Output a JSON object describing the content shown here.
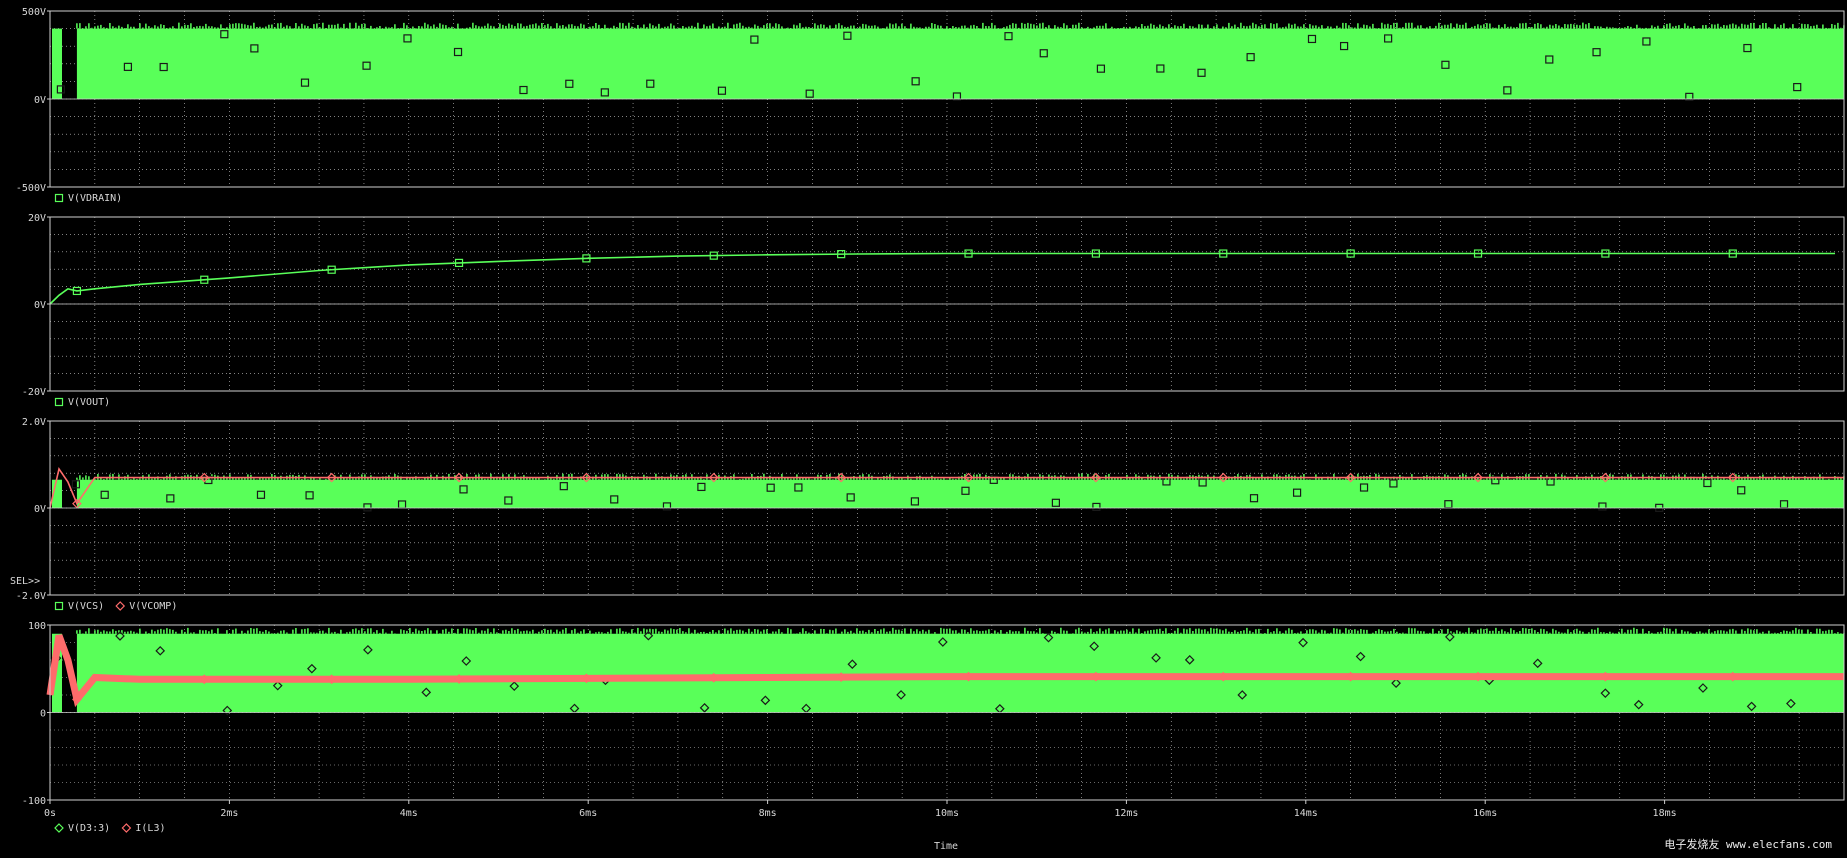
{
  "colors": {
    "background": "#000000",
    "frame": "#cfcfcf",
    "grid": "#cfcfcf",
    "text": "#d8d8d8",
    "trace_green": "#59ff59",
    "trace_red": "#ff6b6b"
  },
  "x_axis": {
    "label": "Time",
    "tick_labels": [
      "0s",
      "2ms",
      "4ms",
      "6ms",
      "8ms",
      "10ms",
      "12ms",
      "14ms",
      "16ms",
      "18ms"
    ],
    "range_ms": [
      0,
      20
    ]
  },
  "sel_marker": "SEL>>",
  "watermark_text": "电子发烧友 www.elecfans.com",
  "chart_data": [
    {
      "type": "line",
      "ylim": [
        -500,
        500
      ],
      "y_tick_labels": [
        "500V",
        "0V",
        "-500V"
      ],
      "y_tick_values": [
        500,
        0,
        -500
      ],
      "series": [
        {
          "name": "V(VDRAIN)",
          "marker": "square",
          "color": "#59ff59",
          "style": "band",
          "band": [
            0,
            400
          ],
          "start_ms": 0.3
        }
      ]
    },
    {
      "type": "line",
      "ylim": [
        -20,
        20
      ],
      "y_tick_labels": [
        "20V",
        "0V",
        "-20V"
      ],
      "y_tick_values": [
        20,
        0,
        -20
      ],
      "series": [
        {
          "name": "V(VOUT)",
          "marker": "square",
          "color": "#59ff59",
          "style": "line",
          "x": [
            0,
            0.1,
            0.2,
            0.3,
            0.5,
            1.0,
            2.0,
            3.0,
            4.0,
            5.0,
            6.0,
            7.0,
            8.0,
            9.0,
            10.0,
            11.0,
            12.0,
            14.0,
            16.0,
            18.0,
            19.9
          ],
          "y": [
            0,
            2.0,
            3.5,
            3.0,
            3.5,
            4.5,
            6.0,
            7.7,
            9.0,
            9.8,
            10.5,
            11.0,
            11.3,
            11.5,
            11.6,
            11.6,
            11.6,
            11.6,
            11.6,
            11.6,
            11.6
          ]
        }
      ]
    },
    {
      "type": "line",
      "ylim": [
        -2.0,
        2.0
      ],
      "y_tick_labels": [
        "2.0V",
        "0V",
        "-2.0V"
      ],
      "y_tick_values": [
        2.0,
        0,
        -2.0
      ],
      "series": [
        {
          "name": "V(VCS)",
          "marker": "square",
          "color": "#59ff59",
          "style": "band",
          "band": [
            0,
            0.65
          ],
          "start_ms": 0.3
        },
        {
          "name": "V(VCOMP)",
          "marker": "diamond",
          "color": "#ff6b6b",
          "style": "line",
          "x": [
            0,
            0.1,
            0.2,
            0.3,
            0.5,
            20
          ],
          "y": [
            0,
            0.9,
            0.6,
            0.1,
            0.7,
            0.7
          ]
        }
      ]
    },
    {
      "type": "line",
      "ylim": [
        -100,
        100
      ],
      "y_tick_labels": [
        "100",
        "0",
        "-100"
      ],
      "y_tick_values": [
        100,
        0,
        -100
      ],
      "series": [
        {
          "name": "V(D3:3)",
          "marker": "diamond",
          "color": "#59ff59",
          "style": "band",
          "band": [
            0,
            90
          ],
          "start_ms": 0.3
        },
        {
          "name": "I(L3)",
          "marker": "diamond",
          "color": "#ff6b6b",
          "style": "line",
          "x": [
            0,
            0.1,
            0.2,
            0.3,
            0.5,
            1,
            4,
            6,
            8,
            10,
            12,
            14,
            16,
            18,
            20
          ],
          "y": [
            20,
            88,
            60,
            15,
            40,
            38,
            38,
            39,
            40,
            41,
            41,
            41,
            41,
            41,
            41
          ]
        }
      ]
    }
  ]
}
